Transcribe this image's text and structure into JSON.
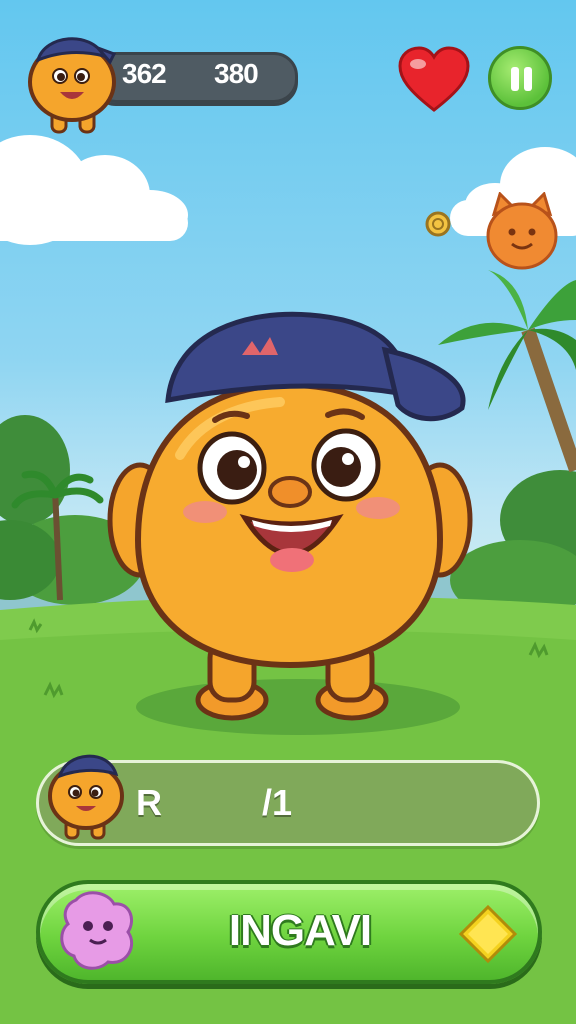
{
  "hud": {
    "score_left": "362",
    "score_right": "380",
    "lives_icon": "heart-icon",
    "pause_icon": "pause-icon"
  },
  "collectibles": {
    "coin_icon": "coin-icon",
    "cat_icon": "cat-face-icon"
  },
  "scene": {
    "character": "orange-blob-with-blue-cap",
    "background": "grassy-field-with-palm-trees"
  },
  "info_bar": {
    "label_left": "R",
    "label_right": "/1"
  },
  "play_button": {
    "label": "INGAVI",
    "left_icon": "pink-blob-icon",
    "right_icon": "yellow-diamond-icon"
  },
  "colors": {
    "sky": "#63c7ef",
    "grass": "#79c94a",
    "button_green": "#6fd43f",
    "character_orange": "#f5a52c",
    "cap_navy": "#3b4788"
  }
}
